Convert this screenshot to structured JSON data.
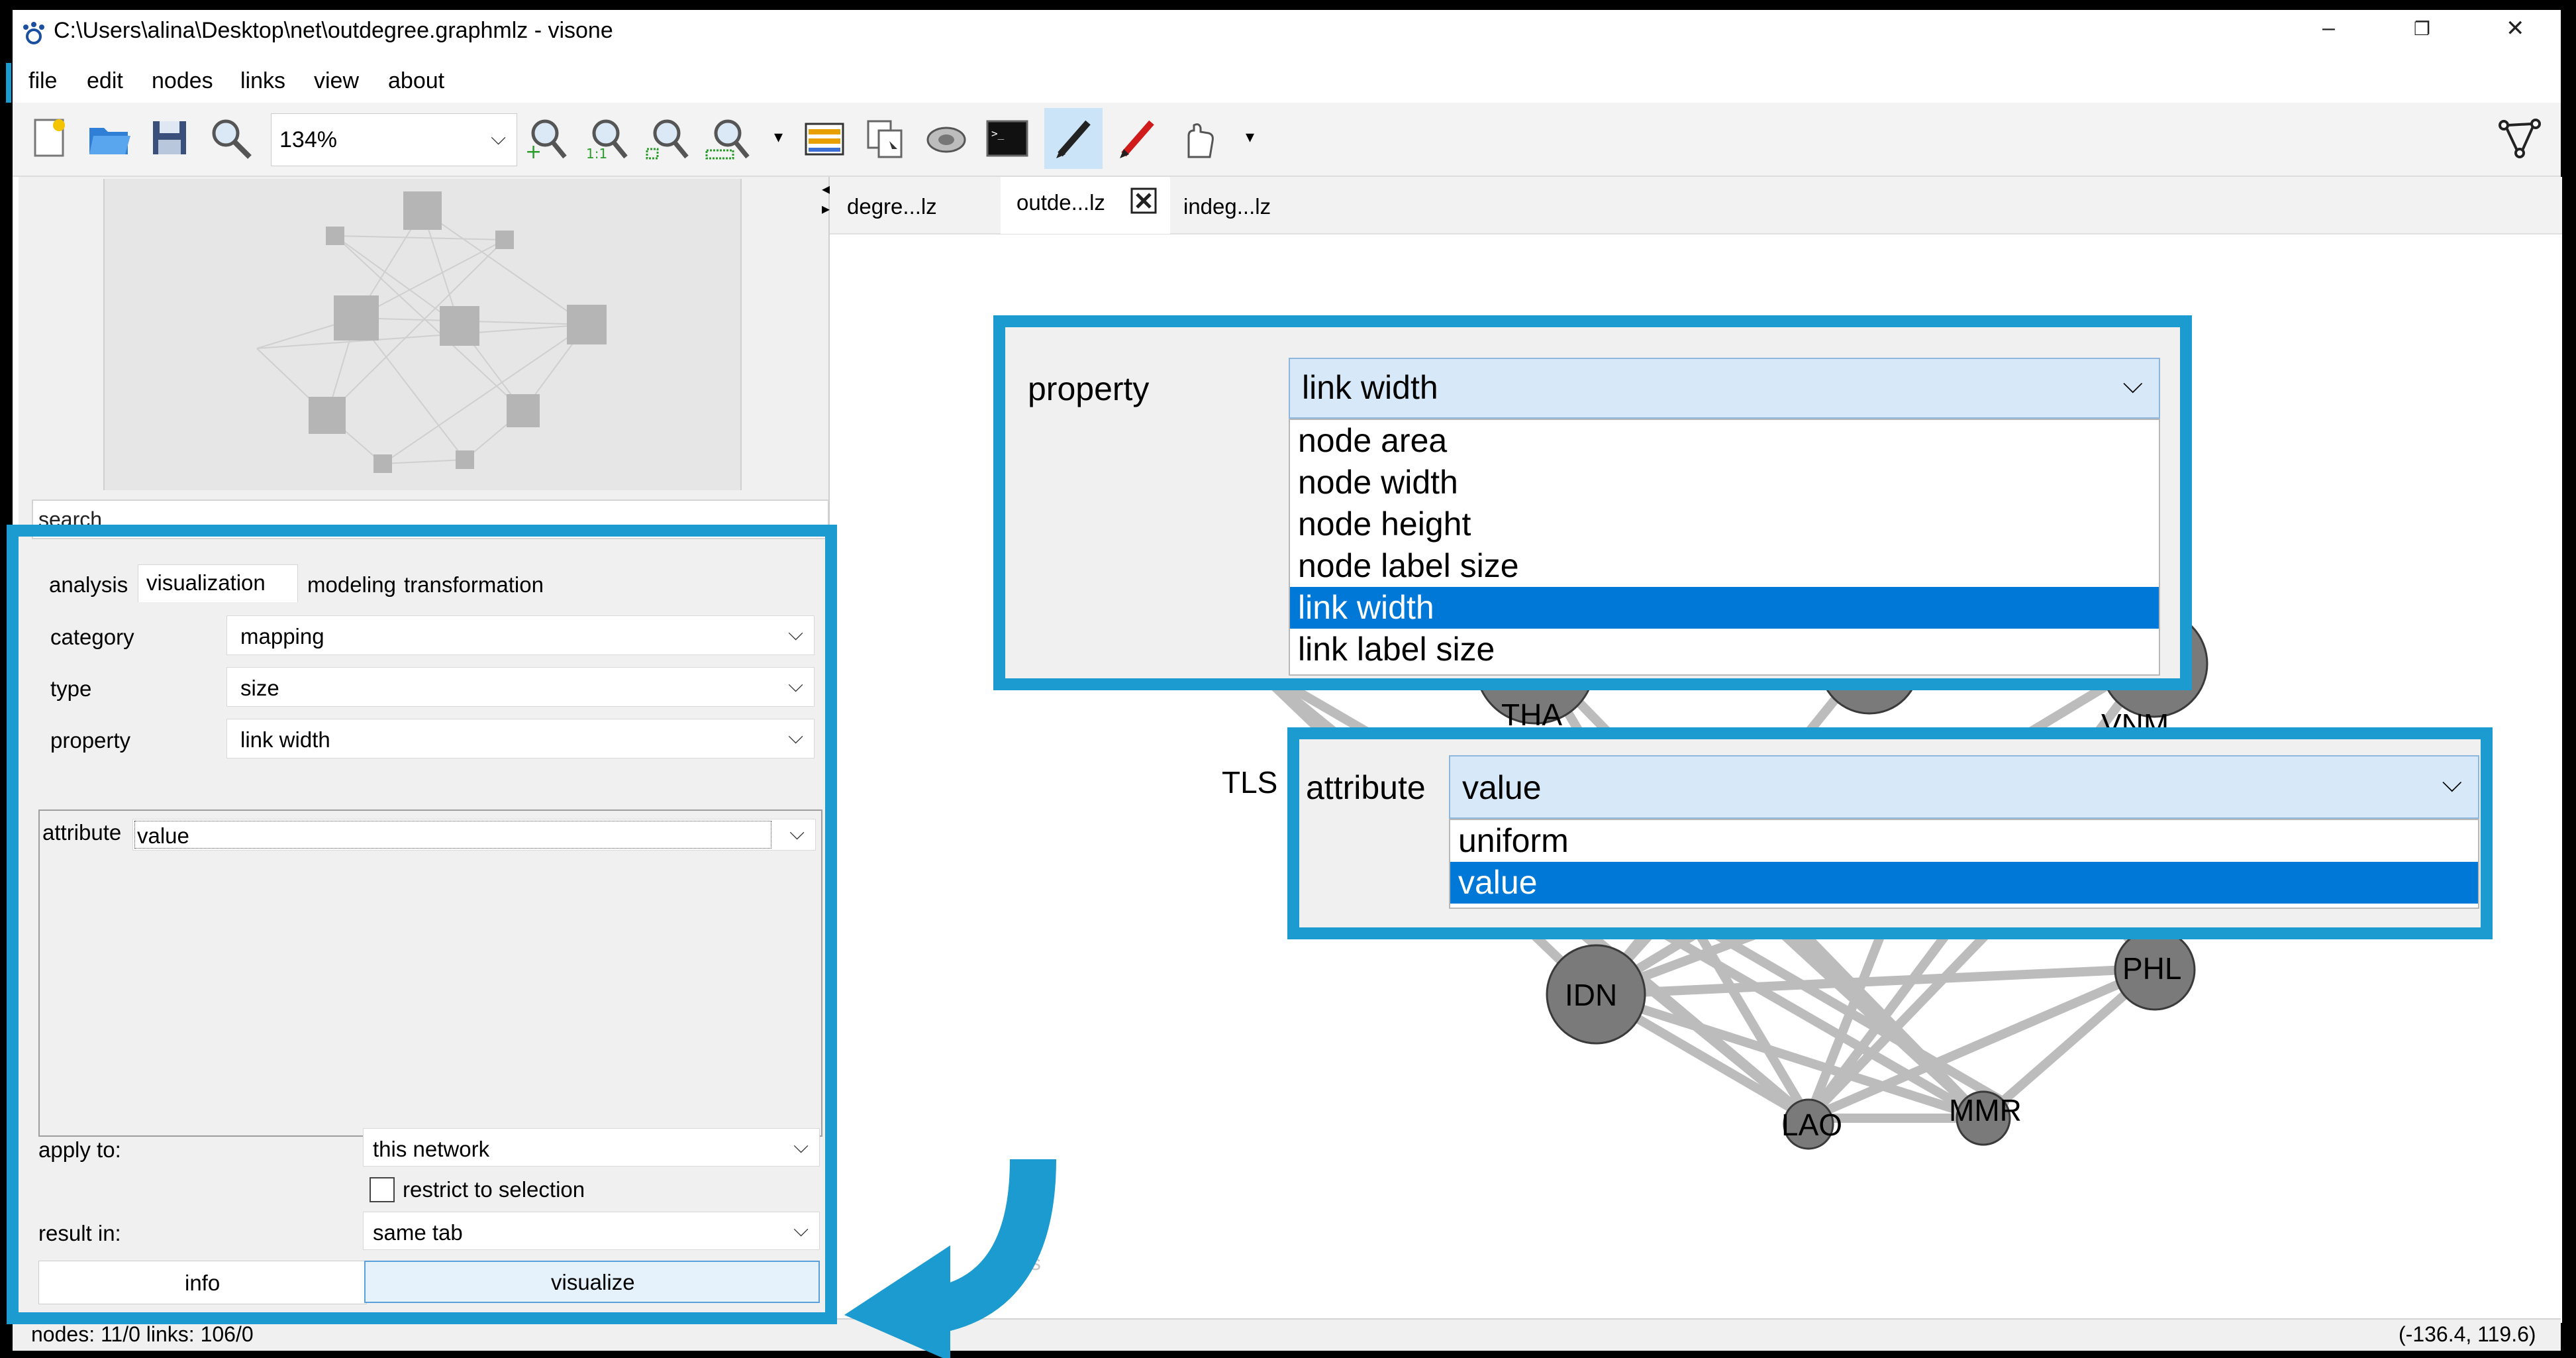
{
  "window": {
    "title": "C:\\Users\\alina\\Desktop\\net\\outdegree.graphmlz - visone",
    "controls": [
      "–",
      "❐",
      "✕"
    ]
  },
  "menu": [
    "file",
    "edit",
    "nodes",
    "links",
    "view",
    "about"
  ],
  "toolbar": {
    "zoom": "134%"
  },
  "left": {
    "search_placeholder": "search",
    "tabs": [
      "analysis",
      "visualization",
      "modeling",
      "transformation"
    ],
    "category_label": "category",
    "category_value": "mapping",
    "type_label": "type",
    "type_value": "size",
    "property_label": "property",
    "property_value": "link width",
    "attribute_label": "attribute",
    "attribute_value": "value",
    "apply_label": "apply to:",
    "apply_value": "this network",
    "restrict_label": "restrict to selection",
    "result_label": "result in:",
    "result_value": "same tab",
    "info_button": "info",
    "visualize_button": "visualize"
  },
  "doc_tabs": [
    "degre...lz",
    "outde...lz",
    "indeg...lz"
  ],
  "popup_property": {
    "label": "property",
    "value": "link width",
    "options": [
      "node area",
      "node width",
      "node height",
      "node label size",
      "link width",
      "link label size"
    ],
    "selected": 4
  },
  "popup_attribute": {
    "label": "attribute",
    "value": "value",
    "options": [
      "uniform",
      "value"
    ],
    "selected": 1
  },
  "graph": {
    "labels": [
      "THA",
      "VNM",
      "TLS",
      "IDN",
      "PHL",
      "LAO",
      "MMR"
    ],
    "faint_text": "files"
  },
  "status": {
    "left": "nodes: 11/0 links: 106/0",
    "right": "(-136.4, 119.6)"
  },
  "colors": {
    "accent": "#1b9bd0",
    "selection": "#0078d7",
    "node_fill": "#7a7a7a",
    "edge": "#b9b9b9"
  }
}
